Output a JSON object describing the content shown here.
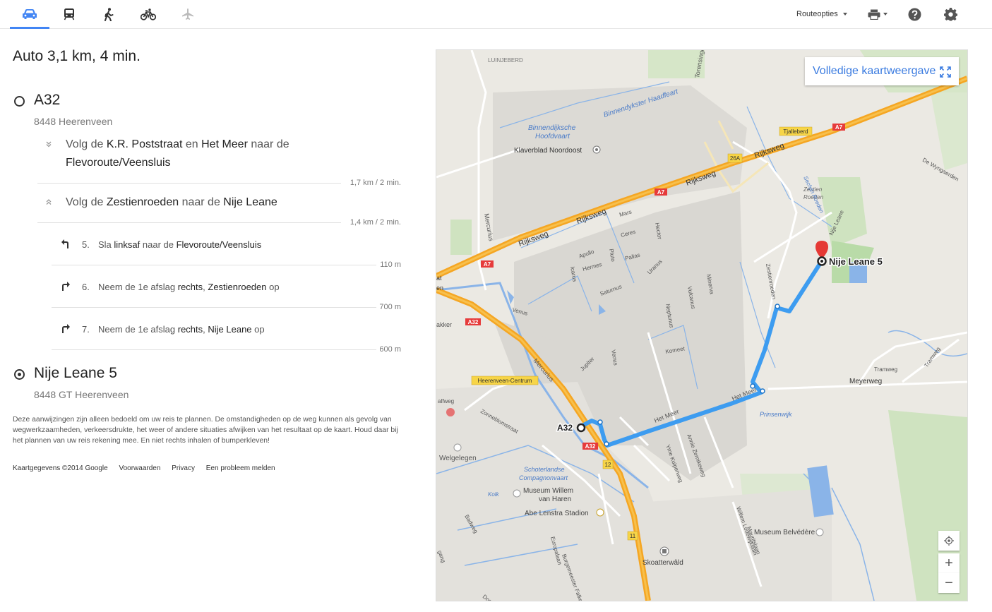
{
  "toolbar": {
    "modes": [
      "car",
      "transit",
      "walking",
      "bicycle",
      "flight"
    ],
    "active_mode": "car",
    "route_options_label": "Routeopties",
    "accent_color": "#4285f4"
  },
  "route": {
    "summary": "Auto 3,1 km, 4 min.",
    "origin": {
      "name": "A32",
      "address": "8448 Heerenveen"
    },
    "groups": [
      {
        "parts": [
          "Volg de ",
          "K.R. Poststraat",
          " en ",
          "Het Meer",
          " naar de ",
          "Flevoroute/Veensluis"
        ],
        "distance": "1,7 km / 2 min.",
        "expanded": false
      },
      {
        "parts": [
          "Volg de ",
          "Zestienroeden",
          " naar de ",
          "Nije Leane"
        ],
        "distance": "1,4 km / 2 min.",
        "expanded": true
      }
    ],
    "steps": [
      {
        "num": "5.",
        "turn": "left",
        "parts": [
          "Sla ",
          "linksaf",
          " naar de ",
          "Flevoroute/Veensluis"
        ],
        "distance": "110 m"
      },
      {
        "num": "6.",
        "turn": "right",
        "parts": [
          "Neem de 1e afslag ",
          "rechts",
          ", ",
          "Zestienroeden",
          " op"
        ],
        "distance": "700 m"
      },
      {
        "num": "7.",
        "turn": "right",
        "parts": [
          "Neem de 1e afslag ",
          "rechts",
          ", ",
          "Nije Leane",
          " op"
        ],
        "distance": "600 m"
      }
    ],
    "destination": {
      "name": "Nije Leane 5",
      "address": "8448 GT Heerenveen"
    }
  },
  "disclaimer": "Deze aanwijzingen zijn alleen bedoeld om uw reis te plannen. De omstandigheden op de weg kunnen als gevolg van wegwerkzaamheden, verkeersdrukte, het weer of andere situaties afwijken van het resultaat op de kaart. Houd daar bij het plannen van uw reis rekening mee. En niet rechts inhalen of bumperkleven!",
  "footer": {
    "copyright": "Kaartgegevens ©2014 Google",
    "terms": "Voorwaarden",
    "privacy": "Privacy",
    "report": "Een probleem melden"
  },
  "map": {
    "full_view_label": "Volledige kaartweergave",
    "route_color": "#3d9cf0",
    "highway_color": "#f5a623",
    "labels": {
      "luinjeberd": "LUINJEBERD",
      "haadfeart": "Binnendykster Haadfeart",
      "hoofdvaart1": "Binnendijksche",
      "hoofdvaart2": "Hoofdvaart",
      "klaverblad": "Klaverblad Noordoost",
      "rijksweg1": "Rijksweg",
      "rijksweg2": "Rijksweg",
      "rijksweg3": "Rijksweg",
      "rijksweg4": "Rijksweg",
      "mercurius1": "Mercurius",
      "mercurius2": "Mercurius",
      "mars": "Mars",
      "ceres": "Ceres",
      "hector": "Hector",
      "apollo": "Apollo",
      "pluto": "Pluto",
      "pallas": "Pallas",
      "icarus": "Icarus",
      "hermes": "Hermes",
      "uranus": "Uranus",
      "saturnus": "Saturnus",
      "vulcanus": "Vulcanus",
      "minerva": "Minerva",
      "neptunus": "Neptunus",
      "venus1": "Venus",
      "venus2": "Venus",
      "jupiter": "Jupiter",
      "komeet": "Komeet",
      "zestienroeden_road": "Zestienroeden",
      "zestien1": "Zestien",
      "zestien2": "Roeden",
      "sechjin": "Sechjin Roeden",
      "nijeleane_road": "Nije Leane",
      "wyngaerden": "De Wyngaerden",
      "meyerweg": "Meyerweg",
      "tramweg1": "Tramweg",
      "tramweg2": "Tramweg",
      "prinsenwijk": "Prinsenwijk",
      "hetmeer1": "Het Meer",
      "hetmeer2": "Het Meer",
      "zonneblom": "Zonneblomstraat",
      "akker": "akker",
      "halfweg": "alfweg",
      "welgelegen": "Welgelegen",
      "schoterlandse1": "Schoterlandse",
      "schoterlandse2": "Compagnonvaart",
      "museum1": "Museum Willem",
      "museum2": "van Haren",
      "abe": "Abe Lenstra Stadion",
      "kolk": "Kolk",
      "badweg": "Badweg",
      "gang": "gang",
      "europalaan": "Europalaan",
      "burgemeester": "Burgemeester Falke",
      "yme": "Yme Kuiperweg",
      "annie": "Annie Zernikeweg",
      "willem1": "Willem Lodewijklaan",
      "maurits": "Mauritslaan",
      "belvedere": "Museum Belvédère",
      "skoatter": "Skoatterwâld",
      "dor": "Dor",
      "torensingel": "Torensingel",
      "leftcut1": "at",
      "leftcut2": "en"
    },
    "shields": {
      "a7_1": "A7",
      "a7_2": "A7",
      "a7_3": "A7",
      "a32_1": "A32",
      "a32_2": "A32",
      "x26a": "26A",
      "x12": "12",
      "x11": "11",
      "tjalleberd": "Tjalleberd",
      "heerenveen_centrum": "Heerenveen-Centrum"
    },
    "origin_label": "A32",
    "destination_label": "Nije Leane 5",
    "zoom_in": "+",
    "zoom_out": "−"
  }
}
